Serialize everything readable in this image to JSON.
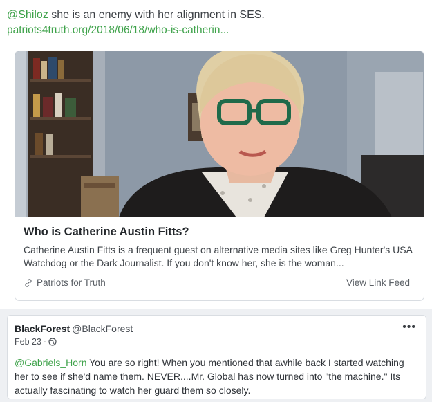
{
  "post": {
    "mention": "@Shiloz",
    "text": " she is an enemy with her alignment in SES.",
    "link_url": "patriots4truth.org/2018/06/18/who-is-catherin..."
  },
  "card": {
    "title": "Who is Catherine Austin Fitts?",
    "description": "Catherine Austin Fitts is a frequent guest on alternative media sites like Greg Hunter's USA Watchdog or the Dark Journalist. If you don't know her, she is the woman...",
    "source": "Patriots for Truth",
    "feed_link": "View Link Feed",
    "image_icon": "person-video-thumbnail"
  },
  "reply": {
    "author_name": "BlackForest",
    "author_handle": "@BlackForest",
    "date": "Feb 23",
    "separator": "·",
    "more_label": "•••",
    "mention": "@Gabriels_Horn",
    "text": " You are so right! When you mentioned that awhile back I started watching her to see if she'd name them. NEVER....Mr. Global has now turned into \"the machine.\" Its actually fascinating to watch her guard them so closely."
  },
  "colors": {
    "accent": "#3ea24a",
    "page_bg": "#eef0f3",
    "border": "#d9dde2"
  }
}
